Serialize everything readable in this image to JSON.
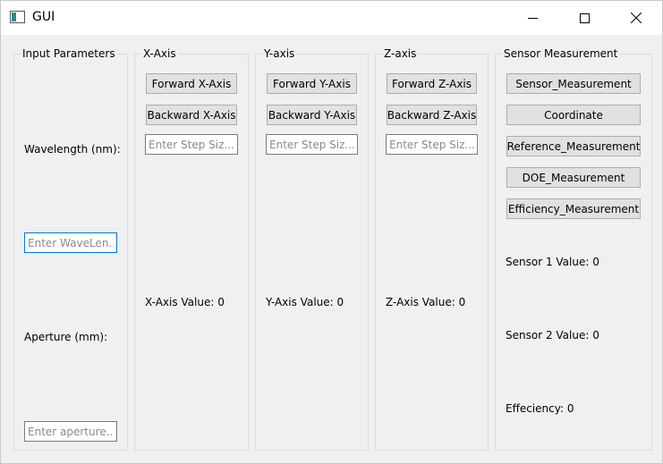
{
  "window": {
    "title": "GUI"
  },
  "input_params": {
    "title": "Input Parameters",
    "wavelength_label": "Wavelength (nm):",
    "wavelength_placeholder": "Enter WaveLen...",
    "aperture_label": "Aperture (mm):",
    "aperture_placeholder": "Enter aperture..."
  },
  "x_axis": {
    "title": "X-Axis",
    "forward": "Forward X-Axis",
    "backward": "Backward X-Axis",
    "step_placeholder": "Enter Step Siz...",
    "value_label": "X-Axis Value: 0"
  },
  "y_axis": {
    "title": "Y-axis",
    "forward": "Forward Y-Axis",
    "backward": "Backward Y-Axis",
    "step_placeholder": "Enter Step Siz...",
    "value_label": "Y-Axis Value: 0"
  },
  "z_axis": {
    "title": "Z-axis",
    "forward": "Forward Z-Axis",
    "backward": "Backward Z-Axis",
    "step_placeholder": "Enter Step Siz...",
    "value_label": "Z-Axis Value: 0"
  },
  "sensor": {
    "title": "Sensor Measurement",
    "buttons": [
      "Sensor_Measurement",
      "Coordinate",
      "Reference_Measurement",
      "DOE_Measurement",
      "Efficiency_Measurement"
    ],
    "sensor1": "Sensor 1 Value: 0",
    "sensor2": "Sensor 2 Value: 0",
    "efficiency": "Effeciency: 0"
  }
}
